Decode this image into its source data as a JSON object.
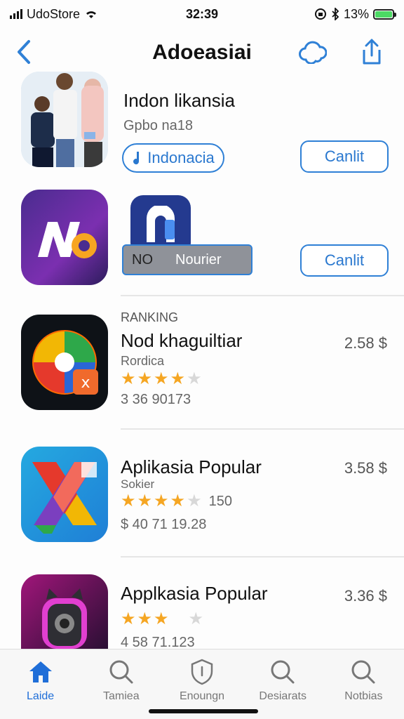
{
  "status_bar": {
    "carrier": "UdoStore",
    "time": "32:39",
    "battery": "13%"
  },
  "nav": {
    "title": "Adoeasiai",
    "back_icon": "chevron-left-icon",
    "cloud_icon": "cloud-icon",
    "share_icon": "share-icon"
  },
  "featured": [
    {
      "title": "Indon likansia",
      "subtitle": "Gpbo na18",
      "tag_label": "Indonacia",
      "button": "Canlit"
    },
    {
      "overlay_label_left": "NO",
      "overlay_label_right": "Nourier",
      "button": "Canlit"
    }
  ],
  "ranking": {
    "label": "RANKING",
    "items": [
      {
        "title": "Nod khaguiltiar",
        "subtitle": "Rordica",
        "rating_stars": 4.5,
        "meta": "3 36 90173",
        "price": "2.58 $"
      },
      {
        "title": "Aplikasia Popular",
        "subtitle": "Sokier",
        "rating_stars": 4.5,
        "rating_count": "150",
        "meta": "$ 40 71 19.28",
        "price": "3.58 $"
      },
      {
        "title": "Applkasia Popular",
        "rating_stars": 3,
        "meta": "4 58 71.123",
        "price": "3.36 $"
      }
    ]
  },
  "tabs": [
    {
      "label": "Laide",
      "icon": "home-icon",
      "active": true
    },
    {
      "label": "Tamiea",
      "icon": "search-icon",
      "active": false
    },
    {
      "label": "Enoungn",
      "icon": "shield-icon",
      "active": false
    },
    {
      "label": "Desiarats",
      "icon": "search-icon",
      "active": false
    },
    {
      "label": "Notbias",
      "icon": "search-icon",
      "active": false
    }
  ],
  "colors": {
    "accent": "#2f80d6",
    "star": "#f5a623",
    "tab_active": "#1f6ed8"
  }
}
